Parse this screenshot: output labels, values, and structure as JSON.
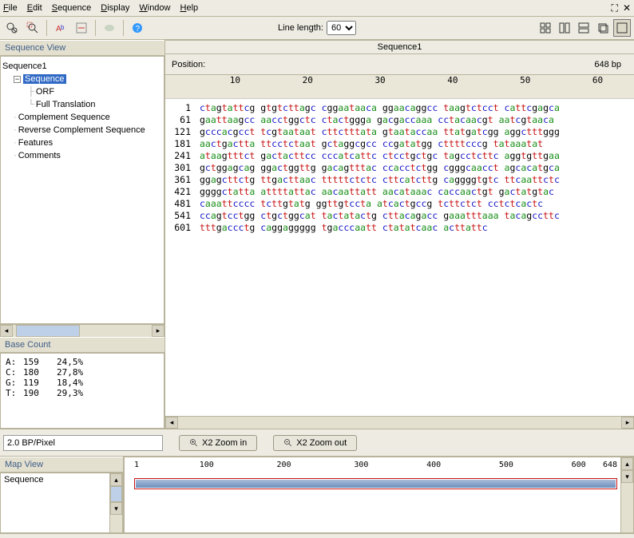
{
  "menu": [
    "File",
    "Edit",
    "Sequence",
    "Display",
    "Window",
    "Help"
  ],
  "toolbar": {
    "line_length_label": "Line length:",
    "line_length_value": "60"
  },
  "sequence_view": {
    "title": "Sequence View",
    "root": "Sequence1",
    "nodes": {
      "sequence": "Sequence",
      "orf": "ORF",
      "full_translation": "Full Translation",
      "complement": "Complement Sequence",
      "reverse_complement": "Reverse Complement Sequence",
      "features": "Features",
      "comments": "Comments"
    }
  },
  "base_count": {
    "title": "Base Count",
    "rows": [
      {
        "base": "A:",
        "count": "159",
        "pct": "24,5%"
      },
      {
        "base": "C:",
        "count": "180",
        "pct": "27,8%"
      },
      {
        "base": "G:",
        "count": "119",
        "pct": "18,4%"
      },
      {
        "base": "T:",
        "count": "190",
        "pct": "29,3%"
      }
    ]
  },
  "seq_panel": {
    "title": "Sequence1",
    "position_label": "Position:",
    "length": "648 bp",
    "ruler": [
      "10",
      "20",
      "30",
      "40",
      "50",
      "60"
    ],
    "lines": [
      {
        "n": "1",
        "seq": "ctagtattcg gtgtcttagc cggaataaca ggaacaggcc taagtctcct cattcgagca"
      },
      {
        "n": "61",
        "seq": "gaattaagcc aacctggctc ctactggga gacgaccaaa cctacaacgt aatcgtaaca"
      },
      {
        "n": "121",
        "seq": "gcccacgcct tcgtaataat cttctttata gtaataccaa ttatgatcgg aggctttggg"
      },
      {
        "n": "181",
        "seq": "aactgactta ttcctctaat gctaggcgcc ccgatatgg cttttcccg tataaatat"
      },
      {
        "n": "241",
        "seq": "ataagtttct gactacttcc cccatcattc ctcctgctgc tagcctcttc aggtgttgaa"
      },
      {
        "n": "301",
        "seq": "gctggagcag ggactggttg gacagtttac ccacctctgg cgggcaacct agcacatgca"
      },
      {
        "n": "361",
        "seq": "ggagcttctg ttgacttaac tttttctctc cttcatcttg caggggtgtc ttcaattctc"
      },
      {
        "n": "421",
        "seq": "ggggctatta attttattac aacaattatt aacataaac caccaactgt gactatgtac"
      },
      {
        "n": "481",
        "seq": "caaattcccc tcttgtatg ggttgtccta atcactgccg tcttctct cctctcactc"
      },
      {
        "n": "541",
        "seq": "ccagtcctgg ctgctggcat tactatactg cttacagacc gaaatttaaa tacagccttc"
      },
      {
        "n": "601",
        "seq": "tttgaccctg caggaggggg tgacccaatt ctatatcaac acttattc"
      }
    ]
  },
  "zoom": {
    "bp_per_pixel": "2.0 BP/Pixel",
    "zoom_in": "X2 Zoom in",
    "zoom_out": "X2 Zoom out"
  },
  "map": {
    "title": "Map View",
    "list_item": "Sequence",
    "ruler": [
      {
        "v": "1",
        "p": 0
      },
      {
        "v": "100",
        "p": 15
      },
      {
        "v": "200",
        "p": 31
      },
      {
        "v": "300",
        "p": 47
      },
      {
        "v": "400",
        "p": 62
      },
      {
        "v": "500",
        "p": 77
      },
      {
        "v": "600",
        "p": 92
      },
      {
        "v": "648",
        "p": 100
      }
    ]
  }
}
